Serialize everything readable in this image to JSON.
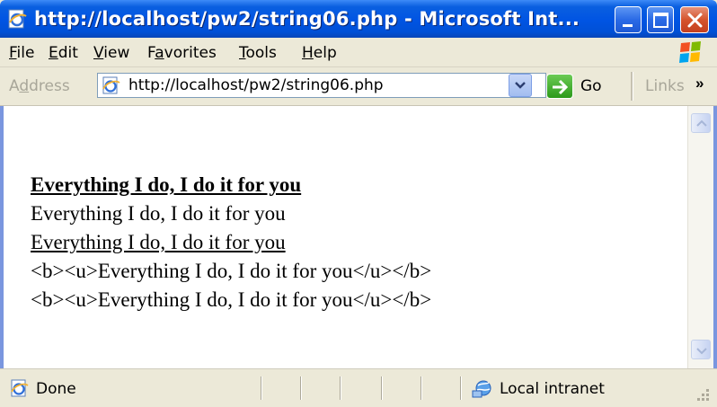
{
  "window": {
    "title": "http://localhost/pw2/string06.php - Microsoft Int..."
  },
  "menu": {
    "items": [
      {
        "accel": "F",
        "rest": "ile"
      },
      {
        "accel": "E",
        "rest": "dit"
      },
      {
        "accel": "V",
        "rest": "iew"
      },
      {
        "pre": "F",
        "accel": "a",
        "rest": "vorites"
      },
      {
        "accel": "T",
        "rest": "ools"
      },
      {
        "accel": "H",
        "rest": "elp"
      }
    ]
  },
  "address_bar": {
    "label_pre": "A",
    "label_accel": "d",
    "label_rest": "dress",
    "url": "http://localhost/pw2/string06.php",
    "go_label": "Go",
    "links_label": "Links",
    "links_more": "»"
  },
  "content": {
    "lines": [
      "Everything I do, I do it for you",
      "Everything I do, I do it for you",
      "Everything I do, I do it for you",
      "<b><u>Everything I do, I do it for you</u></b>",
      "<b><u>Everything I do, I do it for you</u></b>"
    ]
  },
  "status_bar": {
    "status_text": "Done",
    "zone_text": "Local intranet"
  },
  "colors": {
    "titlebar": "#0054e3",
    "frame": "#7a96df",
    "chrome": "#ece9d8"
  },
  "icons": {
    "title": "ie-page-icon",
    "address": "ie-page-icon",
    "go": "go-arrow-icon",
    "status": "ie-page-icon",
    "zone": "local-intranet-icon"
  }
}
